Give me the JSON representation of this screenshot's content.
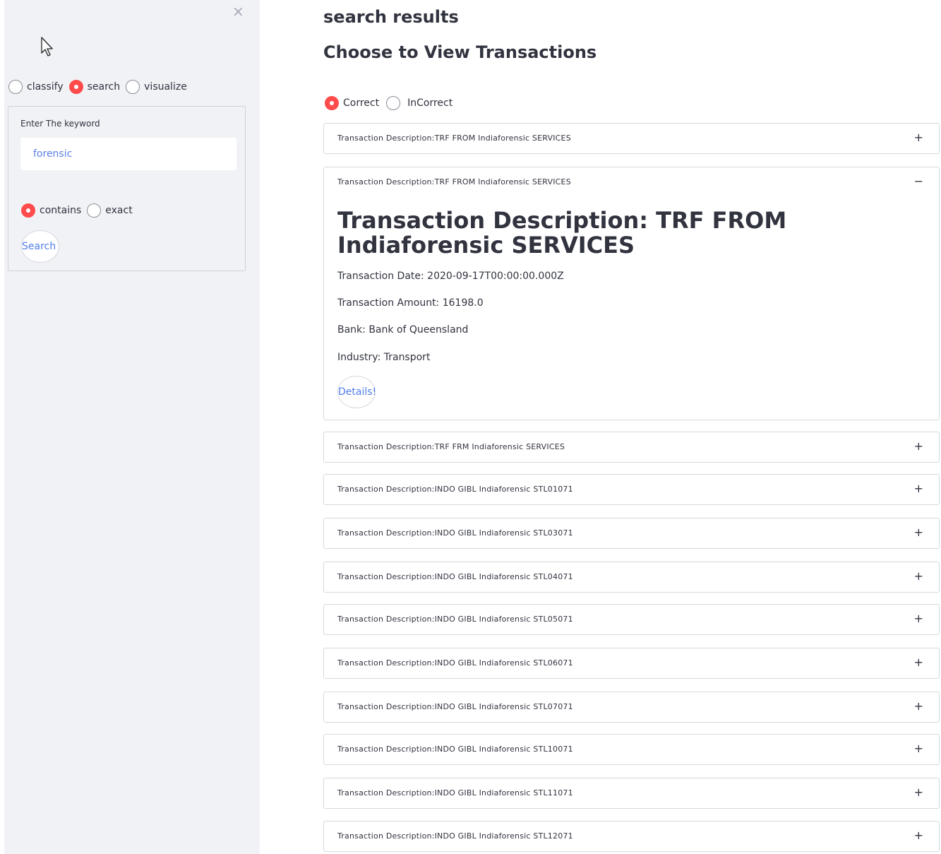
{
  "sidebar": {
    "close_icon": "×",
    "mode_options": [
      {
        "label": "classify",
        "selected": false
      },
      {
        "label": "search",
        "selected": true
      },
      {
        "label": "visualize",
        "selected": false
      }
    ],
    "keyword_label": "Enter The keyword",
    "keyword_value": "forensic",
    "match_options": [
      {
        "label": "contains",
        "selected": true
      },
      {
        "label": "exact",
        "selected": false
      }
    ],
    "search_button": "Search"
  },
  "main": {
    "heading": "search results",
    "subheading": "Choose to View Transactions",
    "filter_options": [
      {
        "label": "Correct",
        "selected": true
      },
      {
        "label": "InCorrect",
        "selected": false
      }
    ],
    "transactions": [
      {
        "title": "Transaction Description:TRF FROM Indiaforensic SERVICES",
        "expanded": false,
        "toggle": "+"
      },
      {
        "title": "Transaction Description:TRF FROM Indiaforensic SERVICES",
        "expanded": true,
        "toggle": "−"
      },
      {
        "title": "Transaction Description:TRF FRM Indiaforensic SERVICES",
        "expanded": false,
        "toggle": "+"
      },
      {
        "title": "Transaction Description:INDO GIBL Indiaforensic STL01071",
        "expanded": false,
        "toggle": "+"
      },
      {
        "title": "Transaction Description:INDO GIBL Indiaforensic STL03071",
        "expanded": false,
        "toggle": "+"
      },
      {
        "title": "Transaction Description:INDO GIBL Indiaforensic STL04071",
        "expanded": false,
        "toggle": "+"
      },
      {
        "title": "Transaction Description:INDO GIBL Indiaforensic STL05071",
        "expanded": false,
        "toggle": "+"
      },
      {
        "title": "Transaction Description:INDO GIBL Indiaforensic STL06071",
        "expanded": false,
        "toggle": "+"
      },
      {
        "title": "Transaction Description:INDO GIBL Indiaforensic STL07071",
        "expanded": false,
        "toggle": "+"
      },
      {
        "title": "Transaction Description:INDO GIBL Indiaforensic STL10071",
        "expanded": false,
        "toggle": "+"
      },
      {
        "title": "Transaction Description:INDO GIBL Indiaforensic STL11071",
        "expanded": false,
        "toggle": "+"
      },
      {
        "title": "Transaction Description:INDO GIBL Indiaforensic STL12071",
        "expanded": false,
        "toggle": "+"
      }
    ],
    "expanded_detail": {
      "title": "Transaction Description: TRF FROM Indiaforensic SERVICES",
      "date": "Transaction Date: 2020-09-17T00:00:00.000Z",
      "amount": "Transaction Amount: 16198.0",
      "bank": "Bank: Bank of Queensland",
      "industry": "Industry: Transport",
      "details_button": "Details!"
    }
  },
  "colors": {
    "accent": "#ff4b4b",
    "sidebar_bg": "#f0f2f6",
    "link_blue": "#4f7ce8"
  }
}
